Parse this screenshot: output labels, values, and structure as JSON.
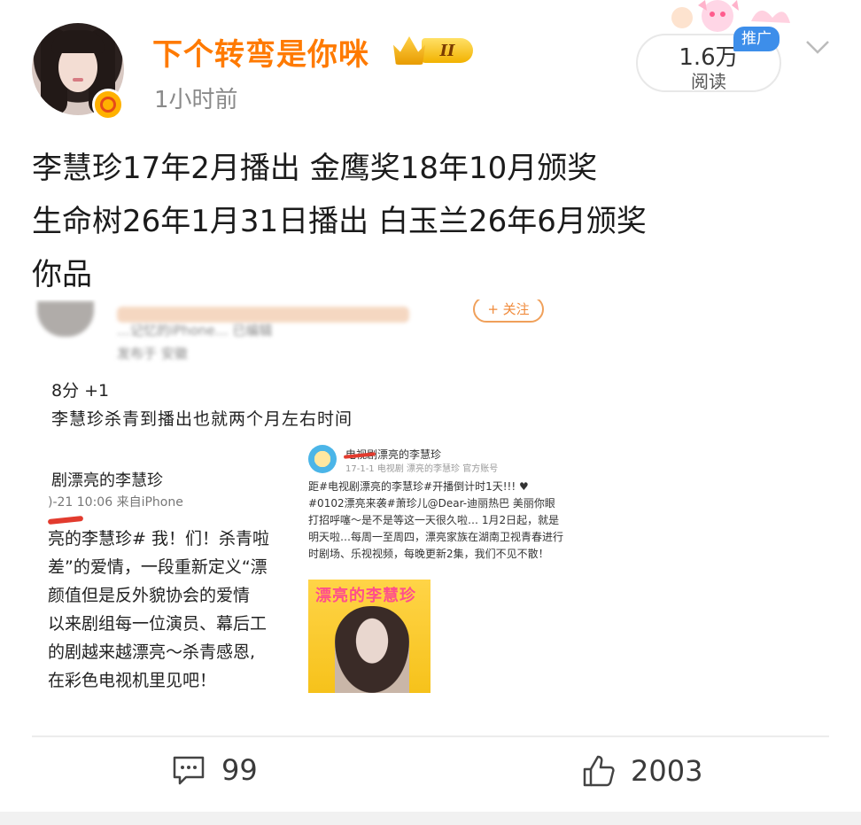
{
  "header": {
    "username": "下个转弯是你咪",
    "level_badge": "II",
    "time": "1小时前",
    "reads_count": "1.6万",
    "reads_label": "阅读",
    "ad_label": "推广"
  },
  "post": {
    "lines": [
      "李慧珍17年2月播出 金鹰奖18年10月颁奖",
      "生命树26年1月31日播出 白玉兰26年6月颁奖",
      "你品"
    ]
  },
  "screenshot": {
    "header_line": "…记忆的iPhone… 已编辑",
    "header_sub": "发布于 安徽",
    "follow": "+ 关注",
    "score": "8分 +1",
    "comment": "李慧珍杀青到播出也就两个月左右时间",
    "left": {
      "title": "剧漂亮的李慧珍",
      "meta": ")-21 10:06 来自iPhone",
      "body": "亮的李慧珍# 我！们！杀青啦\n差”的爱情，一段重新定义“漂\n颜值但是反外貌协会的爱情\n以来剧组每一位演员、幕后工\n的剧越来越漂亮～杀青感恩,\n在彩色电视机里见吧！"
    },
    "right": {
      "title": "电视剧漂亮的李慧珍",
      "meta": "17-1-1 电视剧 漂亮的李慧珍 官方账号",
      "body": "距#电视剧漂亮的李慧珍#开播倒计时1天!!! ♥ #0102漂亮来袭#萧珍儿@Dear-迪丽热巴 美丽你眼打招呼噻～是不是等这一天很久啦… 1月2日起，就是明天啦…每周一至周四，漂亮家族在湖南卫视青春进行时剧场、乐视视频，每晚更新2集，我们不见不散！",
      "poster_title": "漂亮的李慧珍"
    }
  },
  "actions": {
    "comments": "99",
    "likes": "2003"
  },
  "colors": {
    "username": "#ff7a00",
    "ad_tag": "#3d8eea",
    "text": "#1b1b1b",
    "muted": "#8a8a8a"
  }
}
